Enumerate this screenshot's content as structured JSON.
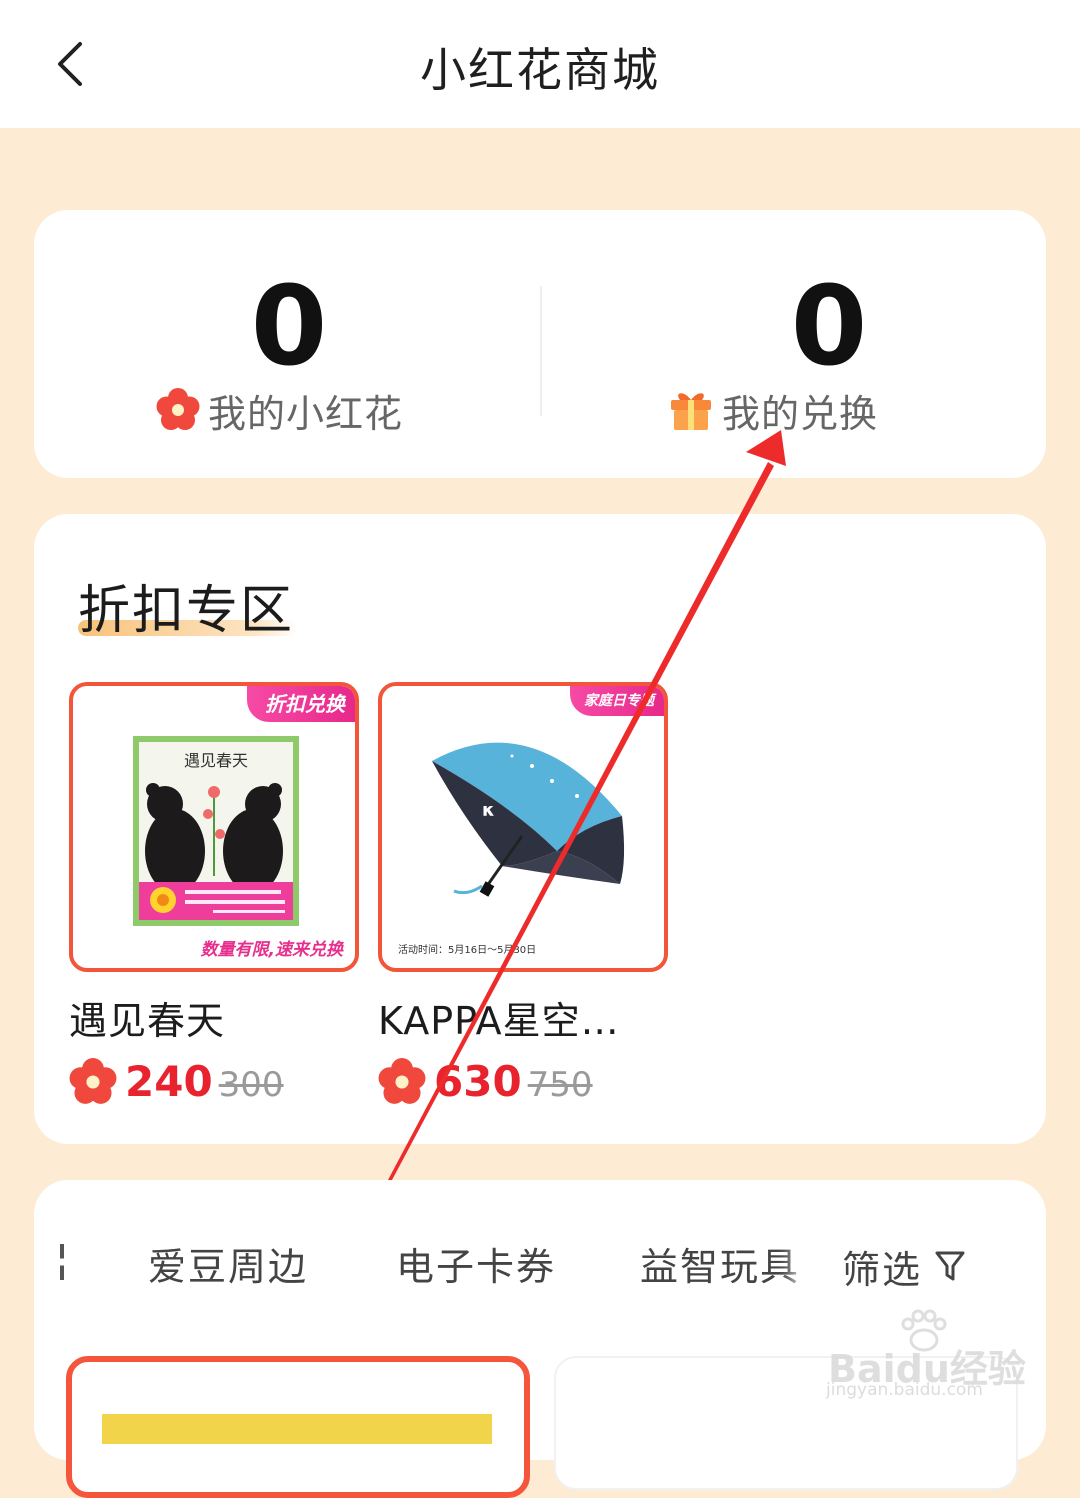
{
  "header": {
    "title": "小红花商城"
  },
  "stats": {
    "flowers": {
      "value": "0",
      "label": "我的小红花"
    },
    "exchanges": {
      "value": "0",
      "label": "我的兑换"
    }
  },
  "discount_section": {
    "title": "折扣专区",
    "products": [
      {
        "name": "遇见春天",
        "price": "240",
        "old_price": "300",
        "tag": "折扣兑换",
        "caption": "数量有限,速来兑换",
        "book_title": "遇见春天"
      },
      {
        "name": "KAPPA星空…",
        "price": "630",
        "old_price": "750",
        "tag": "家庭日专题",
        "caption": "活动时间：5月16日～5月30日"
      }
    ]
  },
  "categories": {
    "tabs": [
      "爱豆周边",
      "电子卡券",
      "益智玩具"
    ],
    "filter_label": "筛选"
  },
  "watermark": {
    "brand": "Baidu经验",
    "url": "jingyan.baidu.com"
  },
  "colors": {
    "accent_red": "#e8232d",
    "frame_orange": "#f2553a",
    "page_bg": "#fdebd4"
  }
}
